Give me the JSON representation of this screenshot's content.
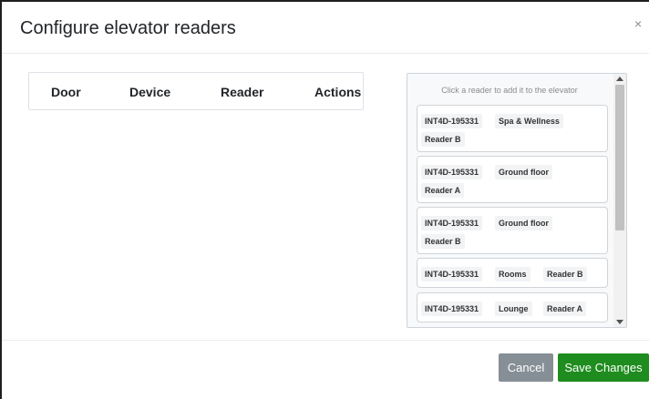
{
  "modal": {
    "title": "Configure elevator readers",
    "close_symbol": "×"
  },
  "table": {
    "columns": [
      "Door",
      "Device",
      "Reader",
      "Actions"
    ],
    "rows": []
  },
  "reader_panel": {
    "hint": "Click a reader to add it to the elevator",
    "readers": [
      {
        "device": "INT4D-195331",
        "door": "Spa & Wellness",
        "reader": "Reader B"
      },
      {
        "device": "INT4D-195331",
        "door": "Ground floor",
        "reader": "Reader A"
      },
      {
        "device": "INT4D-195331",
        "door": "Ground floor",
        "reader": "Reader B"
      },
      {
        "device": "INT4D-195331",
        "door": "Rooms",
        "reader": "Reader B"
      },
      {
        "device": "INT4D-195331",
        "door": "Lounge",
        "reader": "Reader A"
      }
    ]
  },
  "footer": {
    "cancel_label": "Cancel",
    "save_label": "Save Changes"
  },
  "colors": {
    "save": "#1e8c1e",
    "cancel": "#868e96"
  },
  "icons": {
    "close": "close-icon",
    "scroll_up": "chevron-up-icon",
    "scroll_down": "chevron-down-icon"
  }
}
